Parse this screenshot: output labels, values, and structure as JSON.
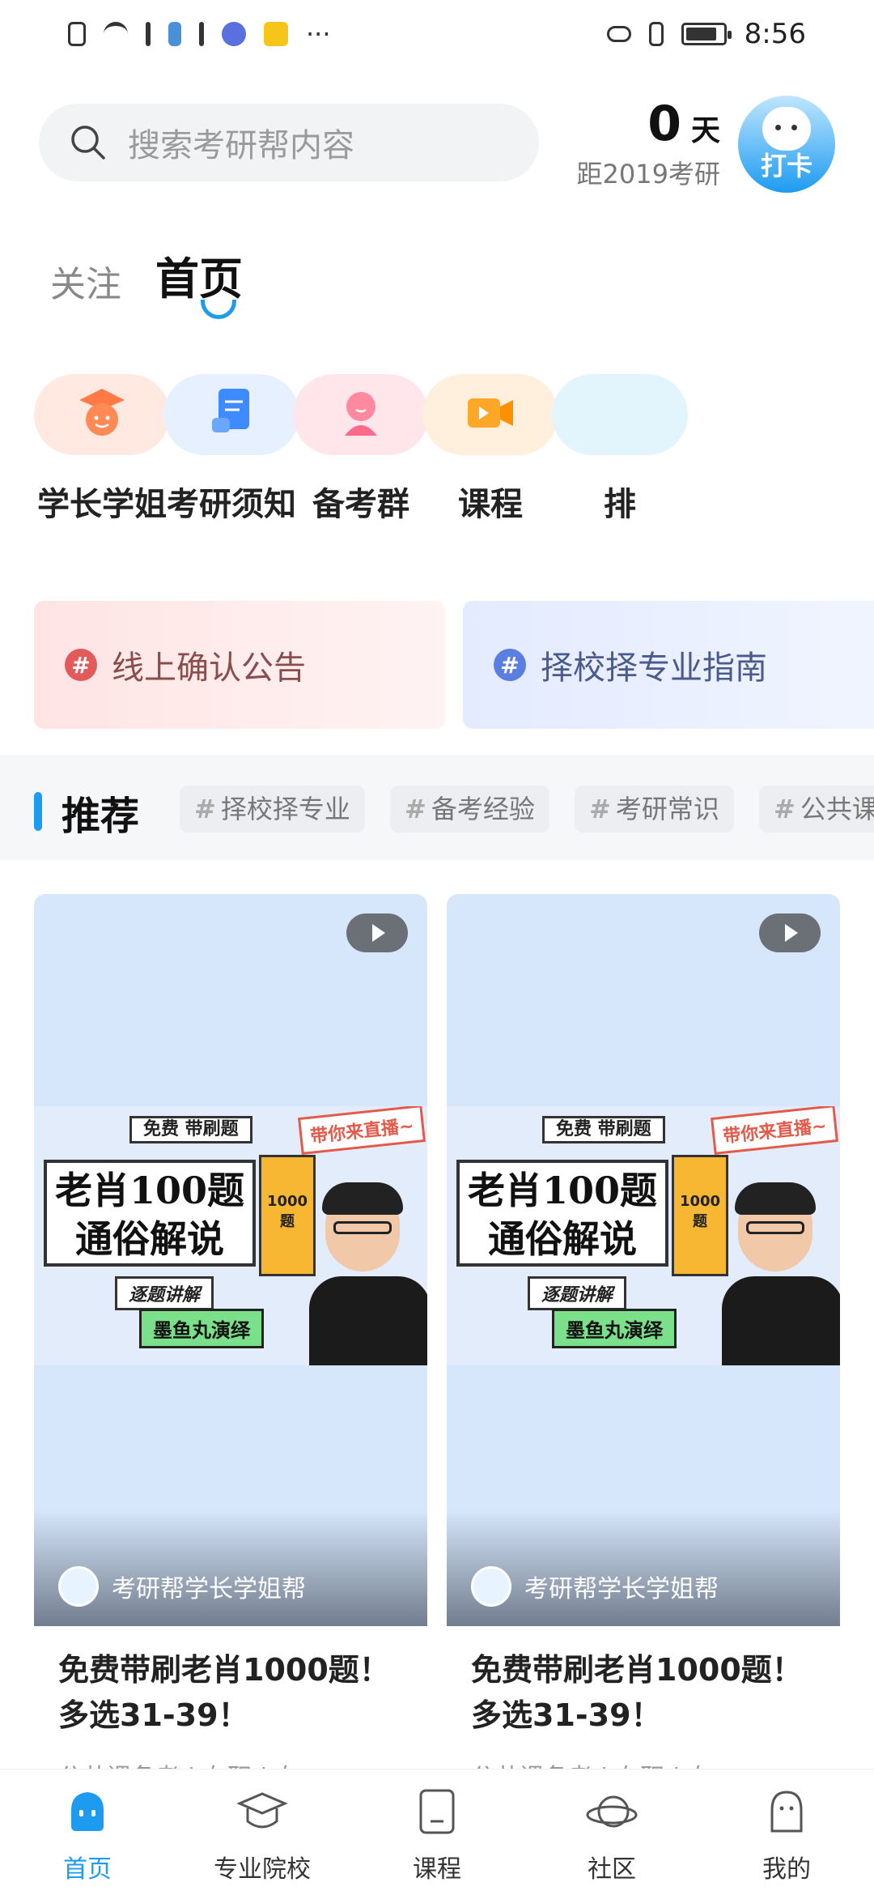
{
  "status_bar": {
    "time": "8:56",
    "more": "···",
    "battery_level": 0.85
  },
  "header": {
    "search_placeholder": "搜索考研帮内容",
    "countdown_number": "0",
    "countdown_unit": "天",
    "countdown_caption": "距2019考研",
    "checkin_label": "打卡"
  },
  "tabs": {
    "follow": "关注",
    "home": "首页"
  },
  "quick_entries": [
    {
      "label": "学长学姐",
      "icon": "graduation-cap-icon",
      "color": "#ff7a45"
    },
    {
      "label": "考研须知",
      "icon": "document-icon",
      "color": "#3d8bff"
    },
    {
      "label": "备考群",
      "icon": "group-avatar-icon",
      "color": "#ff6b8a"
    },
    {
      "label": "课程",
      "icon": "video-icon",
      "color": "#ffa726"
    },
    {
      "label": "排",
      "icon": "partial-icon",
      "color": "#8fd3f4"
    }
  ],
  "notices": [
    {
      "label": "线上确认公告",
      "hash": "#",
      "color": "#e35a5a"
    },
    {
      "label": "择校择专业指南",
      "hash": "#",
      "color": "#5b7fe0"
    }
  ],
  "recommend": {
    "title": "推荐",
    "hash": "#",
    "chips": [
      "择校择专业",
      "备考经验",
      "考研常识",
      "公共课"
    ]
  },
  "cards": [
    {
      "poster_tag": "免费 带刷题",
      "poster_sticker": "带你来直播~",
      "poster_title_line1": "老肖100题",
      "poster_title_line2": "通俗解说",
      "poster_subtitle": "逐题讲解",
      "poster_green": "墨鱼丸演绎",
      "book_text": "1000题",
      "author": "考研帮学长学姐帮",
      "title": "免费带刷老肖1000题！多选31-39！",
      "meta": "公共课备考 | 在职 | 在"
    },
    {
      "poster_tag": "免费 带刷题",
      "poster_sticker": "带你来直播~",
      "poster_title_line1": "老肖100题",
      "poster_title_line2": "通俗解说",
      "poster_subtitle": "逐题讲解",
      "poster_green": "墨鱼丸演绎",
      "book_text": "1000题",
      "author": "考研帮学长学姐帮",
      "title": "免费带刷老肖1000题！多选31-39！",
      "meta": "公共课备考 | 在职 | 在"
    }
  ],
  "bottom_nav": [
    {
      "label": "首页",
      "icon": "home-icon",
      "active": true
    },
    {
      "label": "专业院校",
      "icon": "graduation-cap-icon",
      "active": false
    },
    {
      "label": "课程",
      "icon": "course-icon",
      "active": false
    },
    {
      "label": "社区",
      "icon": "planet-icon",
      "active": false
    },
    {
      "label": "我的",
      "icon": "profile-icon",
      "active": false
    }
  ],
  "colors": {
    "accent": "#1d9bf0",
    "text": "#222222",
    "muted": "#999999"
  }
}
